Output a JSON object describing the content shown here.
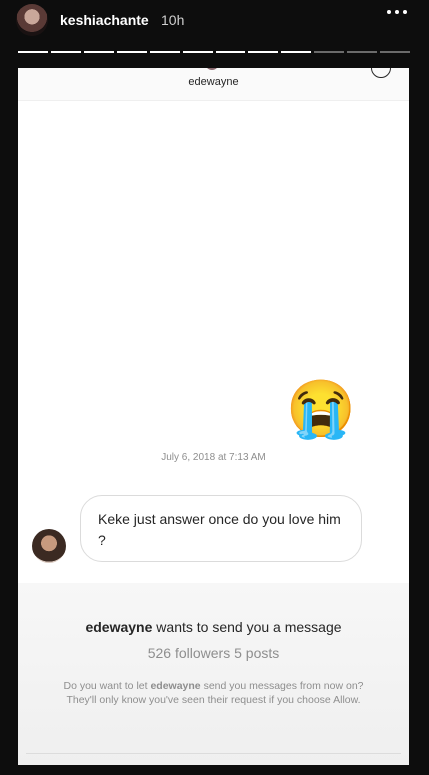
{
  "story": {
    "username": "keshiachante",
    "time": "10h",
    "progress_total": 12,
    "progress_seen": 9
  },
  "chat": {
    "title": "edewayne",
    "timestamp": "July 6, 2018 at 7:13 AM",
    "emoji": "😭",
    "message": "Keke just answer once do you love him ?"
  },
  "request": {
    "username": "edewayne",
    "wants_text": "wants to send you a message",
    "followers": "526 followers",
    "posts": "5 posts",
    "desc_prefix": "Do you want to let",
    "desc_user": "edewayne",
    "desc_suffix": "send you messages from now on? They'll only know you've seen their request if you choose Allow."
  }
}
